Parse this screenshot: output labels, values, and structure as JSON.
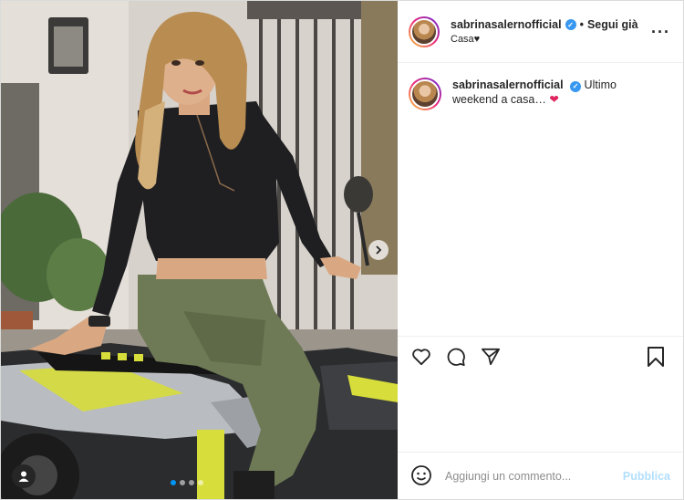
{
  "header": {
    "username": "sabrinasalernofficial",
    "separator": "•",
    "follow_label": "Segui già",
    "location": "Casa♥",
    "more_icon": "more-icon"
  },
  "caption": {
    "username": "sabrinasalernofficial",
    "text": "Ultimo weekend a casa…",
    "emoji": "❤"
  },
  "actions": {
    "like_icon": "heart-icon",
    "comment_icon": "comment-icon",
    "share_icon": "paper-plane-icon",
    "save_icon": "bookmark-icon"
  },
  "comment_box": {
    "placeholder": "Aggiungi un commento...",
    "publish_label": "Pubblica"
  },
  "carousel": {
    "slide_count": 4,
    "active_index": 0
  },
  "colors": {
    "verified": "#3897f0",
    "publish_disabled": "#b2dffc",
    "active_dot": "#0095f6"
  }
}
